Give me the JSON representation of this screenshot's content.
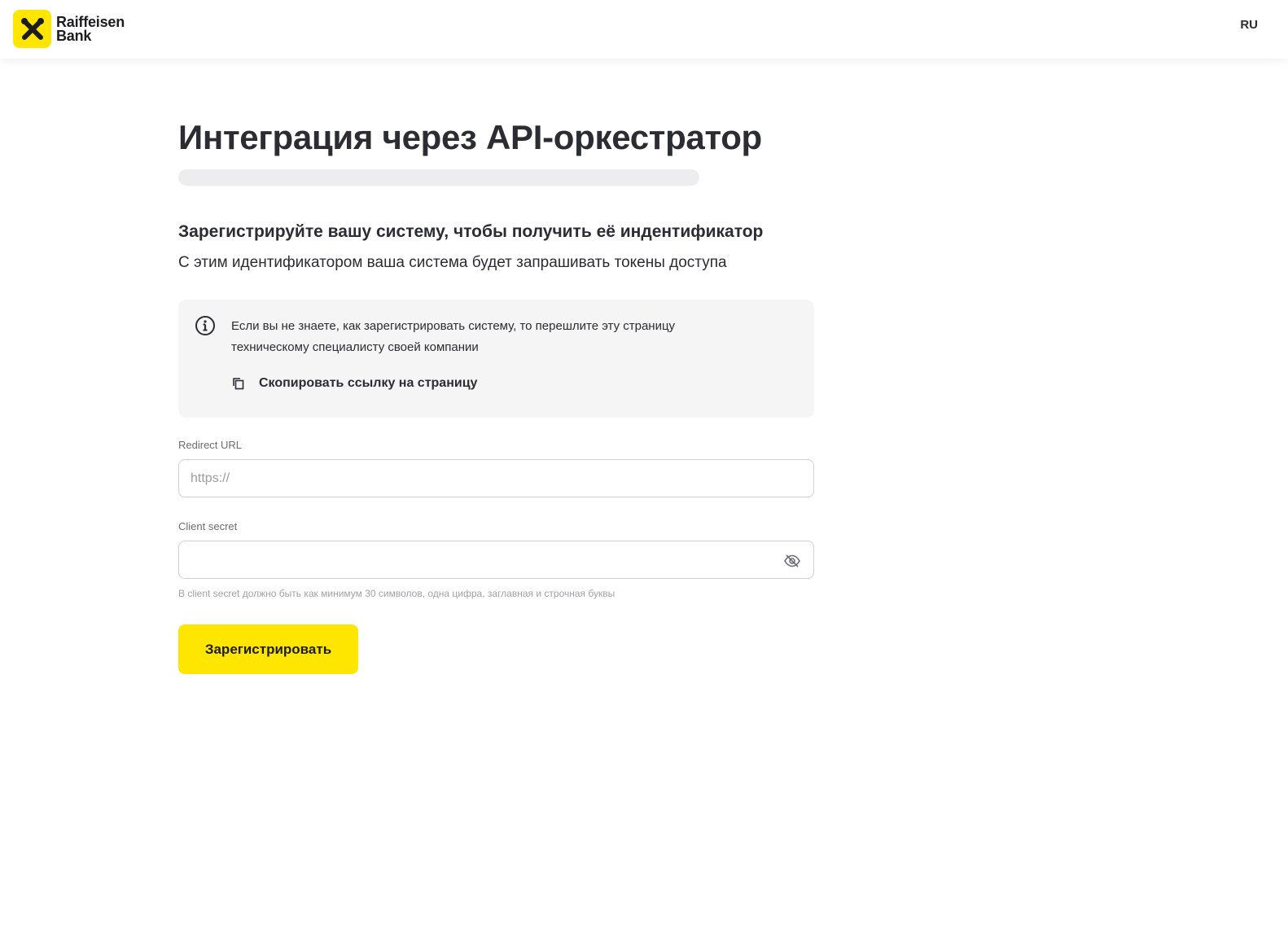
{
  "header": {
    "logo_line1": "Raiffeisen",
    "logo_line2": "Bank",
    "logo_icon": "raiffeisen-crossed-horses-logo",
    "language": "RU"
  },
  "colors": {
    "brand_yellow": "#fee600",
    "text_dark": "#2b2d33",
    "info_bg": "#f5f5f6",
    "track_bg": "#ededef"
  },
  "main": {
    "title": "Интеграция через API-оркестратор",
    "progress_fraction": 0,
    "section_title": "Зарегистрируйте вашу систему, чтобы получить её индентификатор",
    "section_subtitle": "С этим идентификатором ваша система будет запрашивать токены доступа",
    "info": {
      "icon": "info-icon",
      "text": "Если вы не знаете, как зарегистрировать систему, то перешлите эту страницу техническому специалисту своей компании",
      "copy_icon": "copy-icon",
      "copy_label": "Скопировать ссылку на страницу"
    },
    "redirect_url": {
      "label": "Redirect URL",
      "value": "",
      "placeholder": "https://"
    },
    "client_secret": {
      "label": "Client secret",
      "value": "",
      "placeholder": "",
      "toggle_icon": "eye-off-icon",
      "hint": "В client secret должно быть как минимум 30 символов, одна цифра, заглавная и строчная буквы"
    },
    "submit_label": "Зарегистрировать"
  }
}
